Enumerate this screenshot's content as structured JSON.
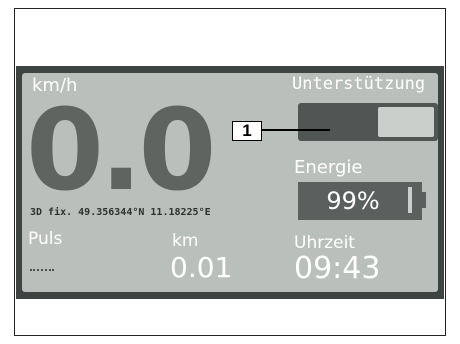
{
  "display": {
    "speed_unit": "km/h",
    "speed_value": "0.0",
    "gps_text": "3D fix. 49.356344°N 11.18225°E",
    "puls_label": "Puls",
    "km_label": "km",
    "km_value": "0.01",
    "support_label": "Unterstützung",
    "energy_label": "Energie",
    "battery_percent": "99%",
    "clock_label": "Uhrzeit",
    "clock_value": "09:43"
  },
  "annotation": {
    "callout_number": "1"
  },
  "colors": {
    "lcd_background": "#b9c0bc",
    "lcd_frame": "#3e4441",
    "lcd_dark": "#5a605d",
    "lcd_text": "#ffffff"
  },
  "icons": [
    "support-level-bar",
    "battery-icon",
    "callout-line"
  ]
}
